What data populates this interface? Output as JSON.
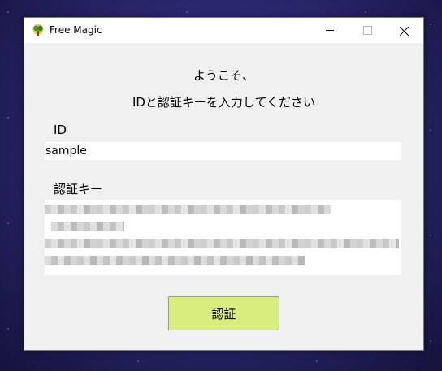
{
  "window": {
    "title": "Free Magic",
    "controls": [
      "minimize-icon",
      "maximize-icon",
      "close-icon"
    ]
  },
  "form": {
    "welcome": "ようこそ、",
    "instruction": "IDと認証キーを入力してください",
    "id_label": "ID",
    "id_value": "sample",
    "key_label": "認証キー",
    "submit_label": "認証"
  },
  "colors": {
    "button": "#d9ed7d",
    "window_bg": "#f0f0f0",
    "titlebar_bg": "#ffffff"
  }
}
